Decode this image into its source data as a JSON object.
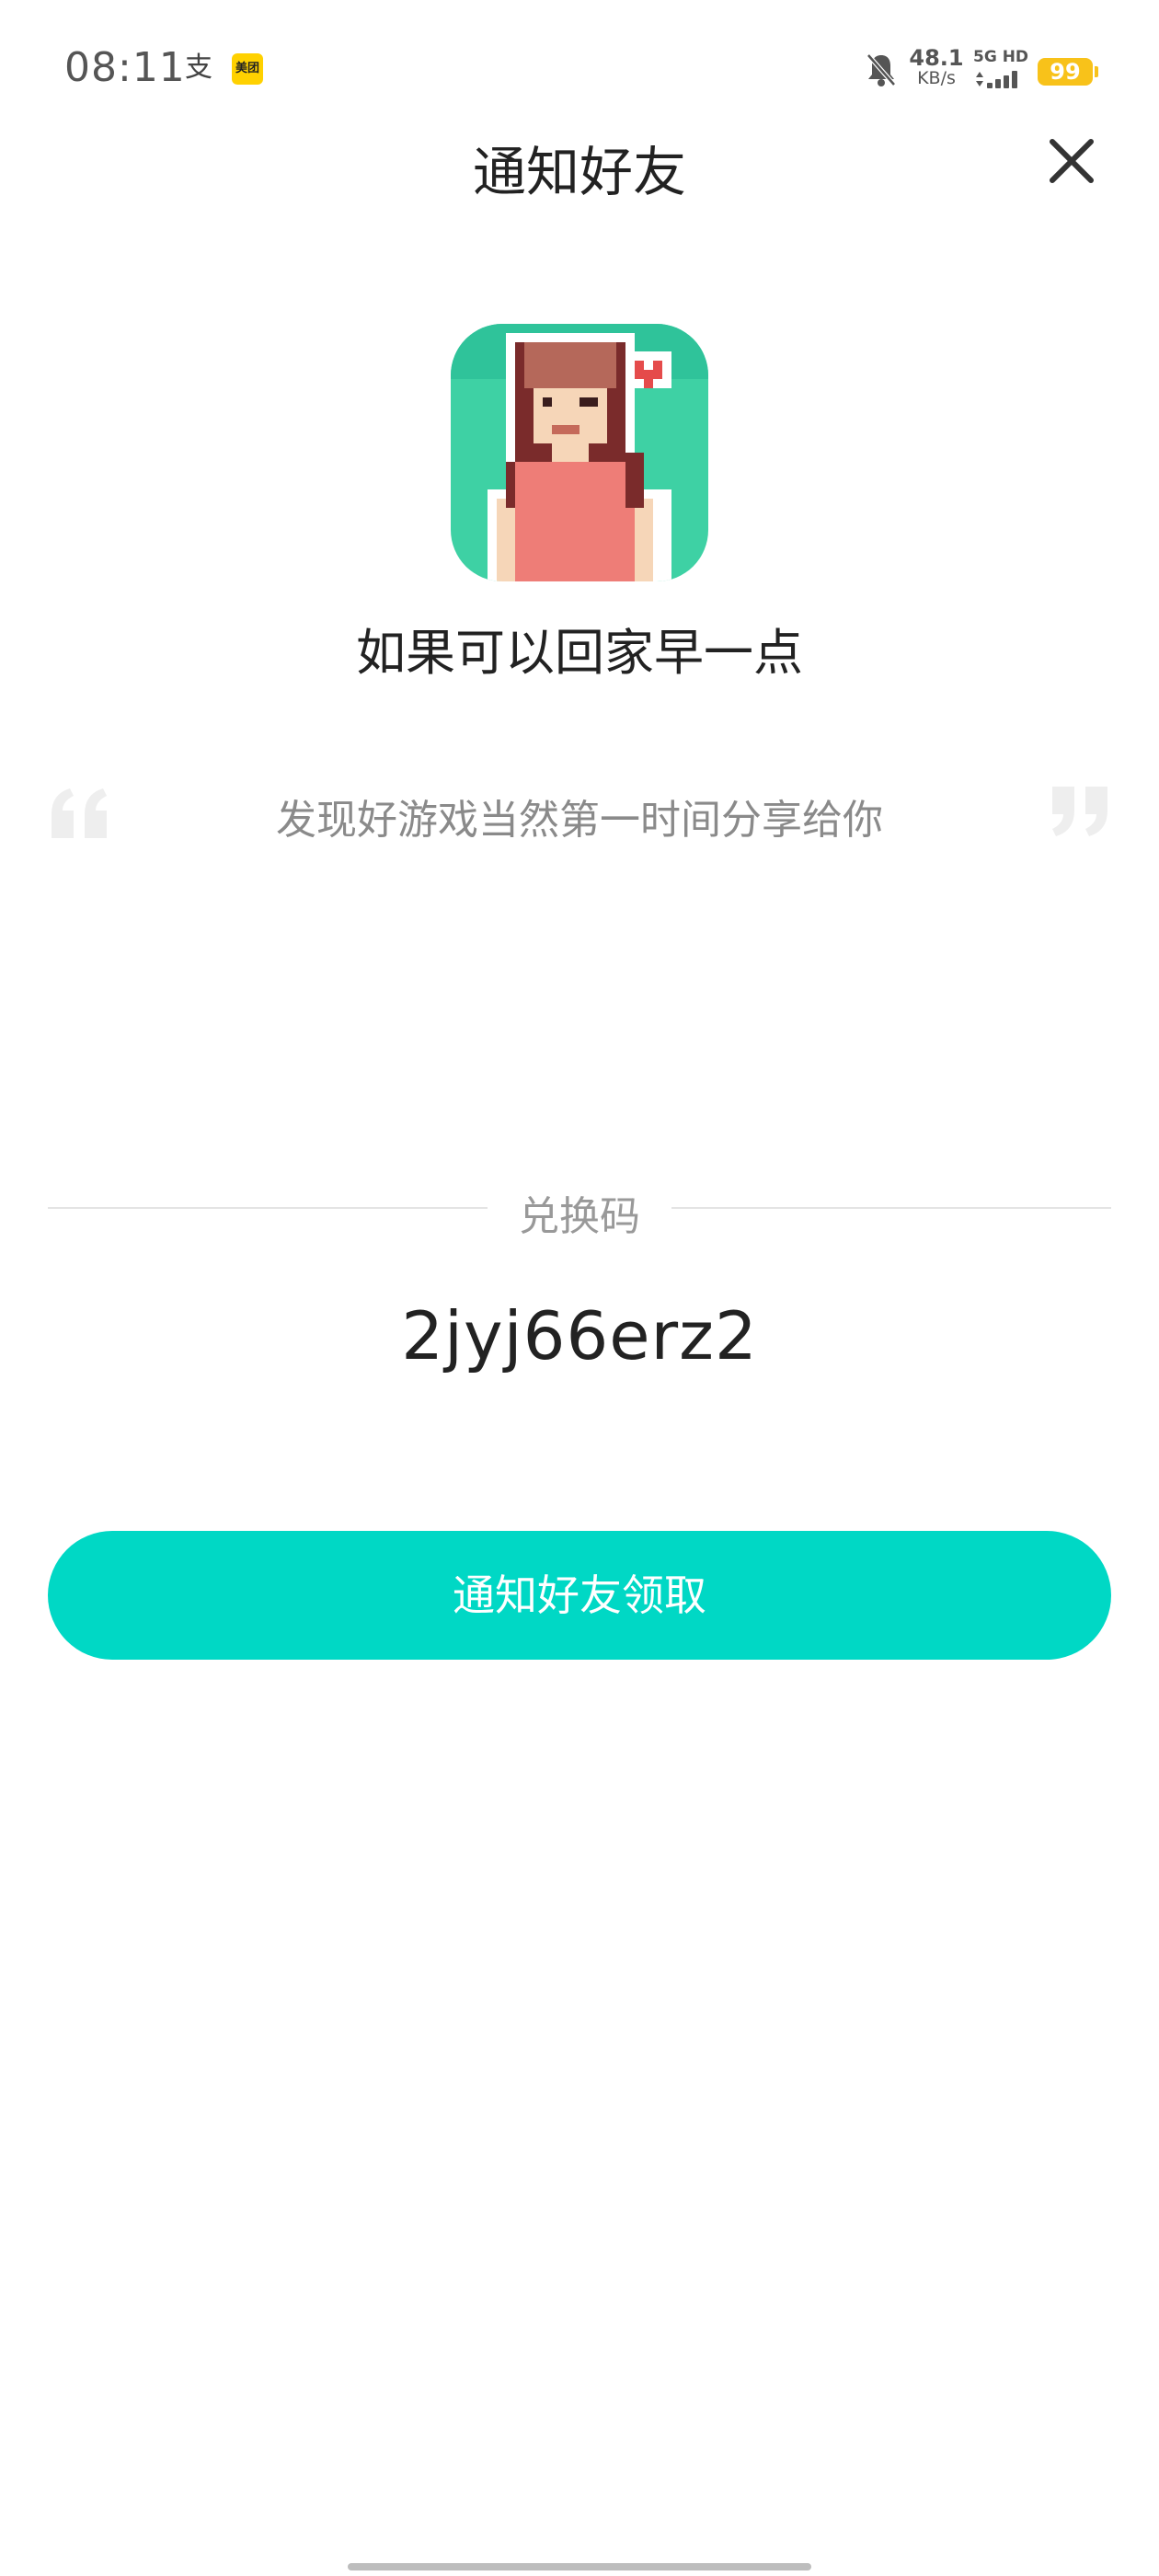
{
  "status_bar": {
    "time": "08:11",
    "alipay_glyph": "支",
    "meituan_label": "美团",
    "net_speed_value": "48.1",
    "net_speed_unit": "KB/s",
    "network_label": "5G HD",
    "battery": "99",
    "icons": [
      "alipay-icon",
      "meituan-icon",
      "bell-muted-icon",
      "signal-icon",
      "battery-icon"
    ],
    "battery_color": "#f8c21a"
  },
  "header": {
    "title": "通知好友",
    "close_icon": "close-icon"
  },
  "game": {
    "name": "如果可以回家早一点",
    "icon": "pixel-girl-app-icon"
  },
  "tagline": {
    "text": "发现好游戏当然第一时间分享给你",
    "quote_icons": [
      "quote-open-icon",
      "quote-close-icon"
    ]
  },
  "redeem": {
    "label": "兑换码",
    "code": "2jyj66erz2"
  },
  "actions": {
    "notify_label": "通知好友领取",
    "accent_color": "#00d8c5"
  }
}
